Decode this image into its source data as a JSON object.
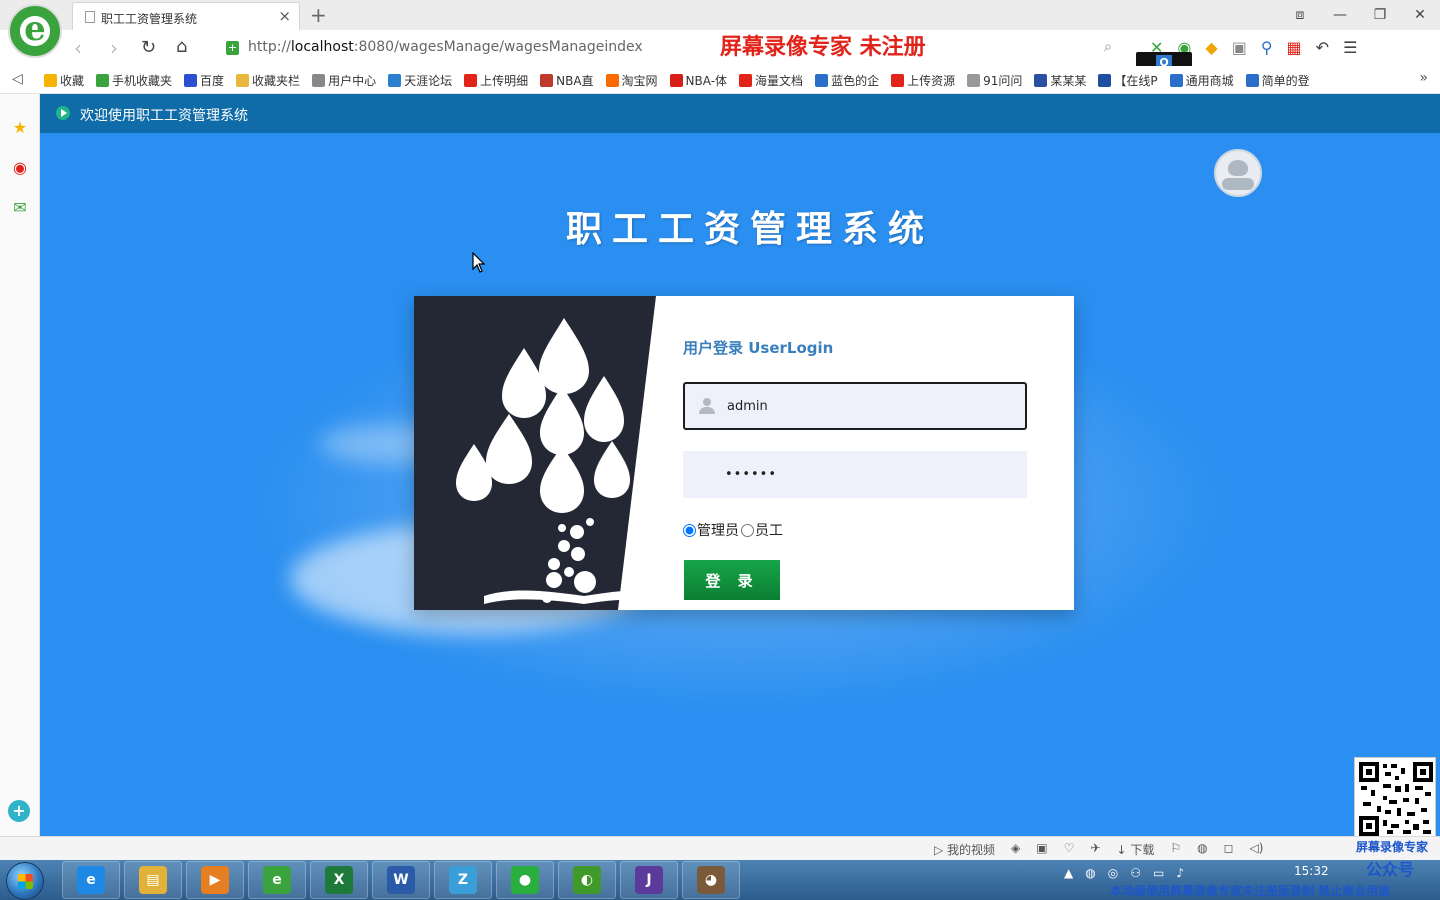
{
  "browser": {
    "logo_letter": "e",
    "tab_title": "职工工资管理系统",
    "tab_close": "×",
    "new_tab": "+",
    "window_controls": [
      "⧈",
      "—",
      "❐",
      "✕"
    ],
    "url_prefix": "http://",
    "url_host": "localhost",
    "url_rest": ":8080/wagesManage/wagesManageindex",
    "secure_glyph": "+",
    "recorder_watermark": "屏幕录像专家 未注册",
    "ctrl_q_label": "Q"
  },
  "bookmarks": [
    {
      "label": "收藏",
      "icon": "star-icon",
      "color": "#f5b400"
    },
    {
      "label": "手机收藏夹",
      "icon": "phone-icon",
      "color": "#3aa33d"
    },
    {
      "label": "百度",
      "icon": "baidu-icon",
      "color": "#2f4fd1"
    },
    {
      "label": "收藏夹栏",
      "icon": "folder-icon",
      "color": "#e8b73c"
    },
    {
      "label": "用户中心",
      "icon": "globe-icon",
      "color": "#888888"
    },
    {
      "label": "天涯论坛",
      "icon": "globe-icon",
      "color": "#2a7fd1"
    },
    {
      "label": "上传明细",
      "icon": "c-icon",
      "color": "#e2231a"
    },
    {
      "label": "NBA直",
      "icon": "nba-icon",
      "color": "#c0392b"
    },
    {
      "label": "淘宝网",
      "icon": "taobao-icon",
      "color": "#ff6a00"
    },
    {
      "label": "NBA-体",
      "icon": "s-icon",
      "color": "#d91e18"
    },
    {
      "label": "海量文档",
      "icon": "doc-icon",
      "color": "#e2231a"
    },
    {
      "label": "蓝色的企",
      "icon": "t-icon",
      "color": "#2a6fc9"
    },
    {
      "label": "上传资源",
      "icon": "c-icon",
      "color": "#e2231a"
    },
    {
      "label": "91问问",
      "icon": "page-icon",
      "color": "#999999"
    },
    {
      "label": "某某某",
      "icon": "shield-icon",
      "color": "#2a4fa0"
    },
    {
      "label": "【在线P",
      "icon": "box-icon",
      "color": "#1f4fa0"
    },
    {
      "label": "通用商城",
      "icon": "t-icon",
      "color": "#2a6fc9"
    },
    {
      "label": "简单的登",
      "icon": "t-icon",
      "color": "#2a6fc9"
    }
  ],
  "header": {
    "welcome": "欢迎使用职工工资管理系统"
  },
  "main": {
    "system_title": "职工工资管理系统"
  },
  "login": {
    "heading": "用户登录  UserLogin",
    "username_value": "admin",
    "password_value": "••••••",
    "roles": [
      {
        "label": "管理员",
        "checked": true
      },
      {
        "label": "员工",
        "checked": false
      }
    ],
    "submit_label": "登 录"
  },
  "statusbar": {
    "items": [
      "▷ 我的视频",
      "◈",
      "▣",
      "♡",
      "✈",
      "↓ 下载",
      "⚐",
      "◍",
      "◻",
      "◁)"
    ],
    "recorder_brand": "屏幕录像专家",
    "recorder_brand_sub": "公众号"
  },
  "taskbar": {
    "apps": [
      {
        "icon": "ie-icon",
        "glyph": "e",
        "color": "#1e88e5"
      },
      {
        "icon": "explorer-icon",
        "glyph": "▤",
        "color": "#e0b23a"
      },
      {
        "icon": "media-player-icon",
        "glyph": "▶",
        "color": "#e67e22"
      },
      {
        "icon": "browser-icon",
        "glyph": "e",
        "color": "#3aa33d"
      },
      {
        "icon": "excel-icon",
        "glyph": "X",
        "color": "#1d7a3a"
      },
      {
        "icon": "word-icon",
        "glyph": "W",
        "color": "#2a5aa8"
      },
      {
        "icon": "notepad-icon",
        "glyph": "Z",
        "color": "#3a9fd9"
      },
      {
        "icon": "wechat-icon",
        "glyph": "●",
        "color": "#2aae3f"
      },
      {
        "icon": "snail-icon",
        "glyph": "◐",
        "color": "#3f9a2a"
      },
      {
        "icon": "java-ee-icon",
        "glyph": "J",
        "color": "#5a3a9a"
      },
      {
        "icon": "dog-avatar-icon",
        "glyph": "◕",
        "color": "#7a5a3a"
      }
    ],
    "tray": [
      "▲",
      "◍",
      "◎",
      "⚇",
      "▭",
      "♪"
    ],
    "clock": "15:32",
    "recorder_notice": "本动画使用屏幕录像专家未注册版录制  禁止商业用途"
  }
}
